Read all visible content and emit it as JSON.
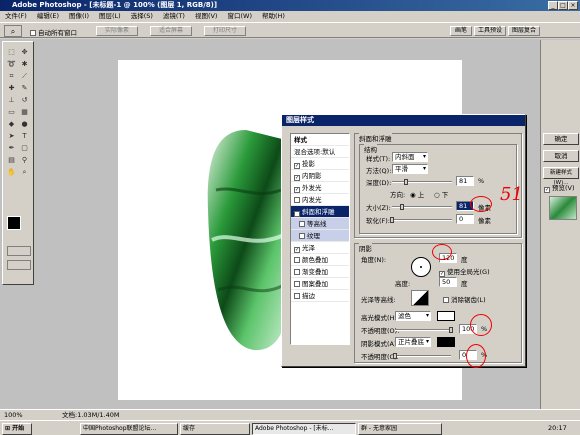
{
  "window_title": "Adobe Photoshop - [未标题-1 @ 100% (图层 1, RGB/8)]",
  "menu": [
    "文件(F)",
    "编辑(E)",
    "图像(I)",
    "图层(L)",
    "选择(S)",
    "滤镜(T)",
    "视图(V)",
    "窗口(W)",
    "帮助(H)"
  ],
  "options": {
    "auto_select": "自动所有窗口",
    "btn1": "实际像素",
    "btn2": "适合屏幕",
    "btn3": "打印尺寸",
    "tab1": "画笔",
    "tab2": "工具预设",
    "tab3": "图层复合"
  },
  "dialog": {
    "title": "图层样式",
    "styles_header": "样式",
    "blend_options": "混合选项:默认",
    "items": [
      "投影",
      "内阴影",
      "外发光",
      "内发光",
      "斜面和浮雕",
      "等高线",
      "纹理",
      "光泽",
      "颜色叠加",
      "渐变叠加",
      "图案叠加",
      "描边"
    ],
    "checked": [
      true,
      true,
      true,
      false,
      true,
      false,
      false,
      true,
      false,
      false,
      false,
      false
    ],
    "bevel_title": "斜面和浮雕",
    "structure": "结构",
    "style_label": "样式(T):",
    "style_value": "内斜面",
    "technique_label": "方法(Q):",
    "technique_value": "平滑",
    "depth_label": "深度(D):",
    "depth_value": "81",
    "depth_unit": "%",
    "direction_label": "方向:",
    "dir_up": "上",
    "dir_down": "下",
    "size_label": "大小(Z):",
    "size_value": "81",
    "size_unit": "像素",
    "soften_label": "软化(F):",
    "soften_value": "0",
    "soften_unit": "像素",
    "shading": "阴影",
    "angle_label": "角度(N):",
    "angle_value": "120",
    "angle_unit": "度",
    "global_light": "使用全局光(G)",
    "altitude_label": "高度:",
    "altitude_value": "50",
    "altitude_unit": "度",
    "gloss_label": "光泽等高线:",
    "antialias": "消除锯齿(L)",
    "highlight_label": "高光模式(H):",
    "highlight_value": "滤色",
    "opacity_label": "不透明度(O):",
    "opacity_value": "100",
    "pct": "%",
    "shadow_label": "阴影模式(A):",
    "shadow_value": "正片叠底",
    "opacity2_label": "不透明度(C):",
    "opacity2_value": "0",
    "ok": "确定",
    "cancel": "取消",
    "new_style": "新建样式(W)...",
    "preview": "预览(V)"
  },
  "annotation": "51",
  "status": {
    "zoom": "100%",
    "doc": "文档:1.03M/1.40M"
  },
  "taskbar": {
    "start": "开始",
    "items": [
      "中国Photoshop联盟论坛...",
      "缓存",
      "Adobe Photoshop - [未标...",
      "群 - 无意家园"
    ],
    "clock": "20:17"
  }
}
